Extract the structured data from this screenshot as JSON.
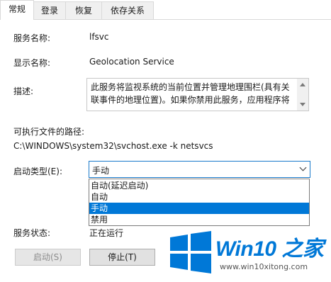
{
  "tabs": [
    "常规",
    "登录",
    "恢复",
    "依存关系"
  ],
  "fields": {
    "service_name_label": "服务名称:",
    "service_name_value": "lfsvc",
    "display_name_label": "显示名称:",
    "display_name_value": "Geolocation Service",
    "description_label": "描述:",
    "description_value": "此服务将监视系统的当前位置并管理地理围栏(具有关联事件的地理位置)。如果你禁用此服务，应用程序将",
    "exe_path_label": "可执行文件的路径:",
    "exe_path_value": "C:\\WINDOWS\\system32\\svchost.exe -k netsvcs",
    "startup_type_label": "启动类型(E):",
    "startup_type_selected": "手动",
    "status_label": "服务状态:",
    "status_value": "正在运行"
  },
  "dropdown_options": [
    "自动(延迟启动)",
    "自动",
    "手动",
    "禁用"
  ],
  "dropdown_selected_index": 2,
  "buttons": {
    "start": "启动(S)",
    "stop": "停止(T)"
  },
  "watermark": {
    "title": "Win10 之家",
    "url": "www.win10xitong.com"
  },
  "colors": {
    "accent": "#0078d7",
    "focus_border": "#1979ca"
  }
}
